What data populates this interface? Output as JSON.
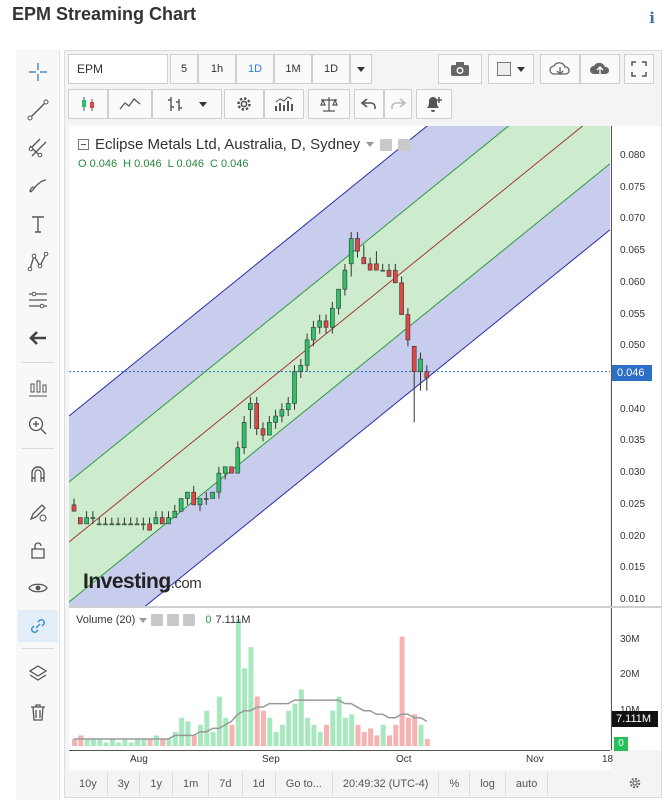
{
  "page": {
    "title": "EPM Streaming Chart",
    "info_icon": "info-icon"
  },
  "left_tools": [
    {
      "name": "crosshair-icon"
    },
    {
      "name": "trend-line-icon"
    },
    {
      "name": "pitchfork-icon"
    },
    {
      "name": "brush-icon"
    },
    {
      "name": "text-icon"
    },
    {
      "name": "pattern-icon"
    },
    {
      "name": "fib-retracement-icon"
    },
    {
      "name": "back-arrow-icon"
    },
    {
      "name": "measure-icon"
    },
    {
      "name": "zoom-in-icon"
    },
    {
      "name": "magnet-icon"
    },
    {
      "name": "stay-in-drawing-icon"
    },
    {
      "name": "lock-icon"
    },
    {
      "name": "eye-icon"
    },
    {
      "name": "link-icon"
    },
    {
      "name": "layers-icon"
    },
    {
      "name": "trash-icon"
    }
  ],
  "toolbar": {
    "symbol": "EPM",
    "intervals": [
      "5",
      "1h",
      "1D",
      "1M",
      "1D"
    ],
    "active_interval": "1D"
  },
  "chart": {
    "legend_title": "Eclipse Metals Ltd, Australia, D, Sydney",
    "ohlc": {
      "o": "O 0.046",
      "h": "H 0.046",
      "l": "L 0.046",
      "c": "C 0.046"
    },
    "last_price": "0.046",
    "watermark": "Investing",
    "watermark_suffix": ".com",
    "colors": {
      "up": "#2ec16a",
      "down": "#e04848",
      "channel_outer": "#c8cdee",
      "channel_inner": "#cdeccd",
      "line": "#2d6ec7"
    }
  },
  "price_axis": [
    "0.080",
    "0.075",
    "0.070",
    "0.065",
    "0.060",
    "0.055",
    "0.050",
    "0.045",
    "0.040",
    "0.035",
    "0.030",
    "0.025",
    "0.020",
    "0.015",
    "0.010"
  ],
  "volume": {
    "legend": "Volume (20)",
    "value": "0",
    "ma_value": "7.111M",
    "axis": [
      "30M",
      "20M",
      "10M"
    ],
    "tag": "7.111M",
    "zero_tag": "0"
  },
  "time_axis": [
    "Aug",
    "Sep",
    "Oct",
    "Nov",
    "18"
  ],
  "bottom_bar": [
    "10y",
    "3y",
    "1y",
    "1m",
    "7d",
    "1d",
    "Go to...",
    "20:49:32 (UTC-4)",
    "%",
    "log",
    "auto"
  ],
  "chart_data": {
    "type": "candlestick",
    "title": "Eclipse Metals Ltd, Australia, D, Sydney",
    "ylim": [
      0.01,
      0.082
    ],
    "x_labels": [
      "Aug",
      "Sep",
      "Oct",
      "Nov",
      "18"
    ],
    "candles": [
      [
        0.025,
        0.026,
        0.024,
        0.024
      ],
      [
        0.023,
        0.023,
        0.022,
        0.022
      ],
      [
        0.022,
        0.024,
        0.022,
        0.023
      ],
      [
        0.023,
        0.024,
        0.022,
        0.023
      ],
      [
        0.022,
        0.023,
        0.022,
        0.022
      ],
      [
        0.022,
        0.023,
        0.022,
        0.022
      ],
      [
        0.022,
        0.023,
        0.022,
        0.022
      ],
      [
        0.022,
        0.023,
        0.022,
        0.022
      ],
      [
        0.022,
        0.023,
        0.022,
        0.022
      ],
      [
        0.022,
        0.023,
        0.022,
        0.022
      ],
      [
        0.022,
        0.023,
        0.022,
        0.022
      ],
      [
        0.022,
        0.023,
        0.021,
        0.022
      ],
      [
        0.022,
        0.023,
        0.021,
        0.021
      ],
      [
        0.022,
        0.024,
        0.022,
        0.023
      ],
      [
        0.023,
        0.024,
        0.022,
        0.022
      ],
      [
        0.022,
        0.024,
        0.022,
        0.023
      ],
      [
        0.023,
        0.025,
        0.023,
        0.024
      ],
      [
        0.024,
        0.026,
        0.024,
        0.026
      ],
      [
        0.026,
        0.027,
        0.025,
        0.027
      ],
      [
        0.027,
        0.028,
        0.025,
        0.025
      ],
      [
        0.025,
        0.026,
        0.024,
        0.026
      ],
      [
        0.026,
        0.027,
        0.025,
        0.026
      ],
      [
        0.026,
        0.027,
        0.026,
        0.027
      ],
      [
        0.027,
        0.031,
        0.026,
        0.03
      ],
      [
        0.03,
        0.031,
        0.029,
        0.031
      ],
      [
        0.031,
        0.031,
        0.03,
        0.03
      ],
      [
        0.03,
        0.035,
        0.03,
        0.034
      ],
      [
        0.034,
        0.039,
        0.033,
        0.038
      ],
      [
        0.04,
        0.042,
        0.037,
        0.041
      ],
      [
        0.041,
        0.042,
        0.036,
        0.037
      ],
      [
        0.037,
        0.038,
        0.035,
        0.036
      ],
      [
        0.036,
        0.039,
        0.036,
        0.038
      ],
      [
        0.038,
        0.04,
        0.037,
        0.039
      ],
      [
        0.039,
        0.041,
        0.038,
        0.04
      ],
      [
        0.04,
        0.042,
        0.039,
        0.041
      ],
      [
        0.041,
        0.047,
        0.04,
        0.046
      ],
      [
        0.046,
        0.048,
        0.045,
        0.047
      ],
      [
        0.047,
        0.052,
        0.046,
        0.051
      ],
      [
        0.051,
        0.054,
        0.05,
        0.053
      ],
      [
        0.053,
        0.055,
        0.052,
        0.054
      ],
      [
        0.054,
        0.055,
        0.052,
        0.053
      ],
      [
        0.053,
        0.057,
        0.052,
        0.056
      ],
      [
        0.056,
        0.059,
        0.055,
        0.059
      ],
      [
        0.059,
        0.063,
        0.058,
        0.062
      ],
      [
        0.063,
        0.068,
        0.061,
        0.067
      ],
      [
        0.067,
        0.068,
        0.064,
        0.065
      ],
      [
        0.064,
        0.066,
        0.063,
        0.063
      ],
      [
        0.063,
        0.064,
        0.062,
        0.062
      ],
      [
        0.063,
        0.065,
        0.062,
        0.062
      ],
      [
        0.062,
        0.063,
        0.062,
        0.062
      ],
      [
        0.062,
        0.063,
        0.061,
        0.061
      ],
      [
        0.062,
        0.063,
        0.061,
        0.06
      ],
      [
        0.06,
        0.061,
        0.055,
        0.055
      ],
      [
        0.055,
        0.056,
        0.05,
        0.051
      ],
      [
        0.05,
        0.05,
        0.038,
        0.046
      ],
      [
        0.046,
        0.049,
        0.043,
        0.048
      ],
      [
        0.046,
        0.047,
        0.043,
        0.045
      ]
    ],
    "volume_millions": [
      2,
      3,
      2,
      2,
      2,
      1,
      2,
      1,
      2,
      1,
      2,
      2,
      2,
      3,
      2,
      2,
      4,
      8,
      7,
      3,
      6,
      10,
      4,
      14,
      8,
      6,
      36,
      22,
      28,
      14,
      10,
      8,
      4,
      6,
      10,
      12,
      16,
      8,
      6,
      4,
      6,
      10,
      14,
      8,
      9,
      6,
      4,
      5,
      3,
      6,
      3,
      6,
      31,
      8,
      9,
      6,
      2
    ],
    "volume_ma_millions": [
      2,
      2,
      2,
      2,
      2,
      2,
      2,
      2,
      2,
      2,
      2,
      2,
      2,
      2,
      2,
      2,
      3,
      3,
      3,
      3,
      4,
      4,
      5,
      5,
      6,
      7,
      9,
      10,
      10,
      11,
      11,
      12,
      12,
      12,
      12,
      13,
      13,
      13,
      13,
      13,
      13,
      13,
      13,
      12,
      12,
      11,
      10,
      10,
      9,
      9,
      8,
      8,
      9,
      9,
      8,
      8,
      7
    ],
    "volume_ylim": [
      0,
      34
    ]
  }
}
